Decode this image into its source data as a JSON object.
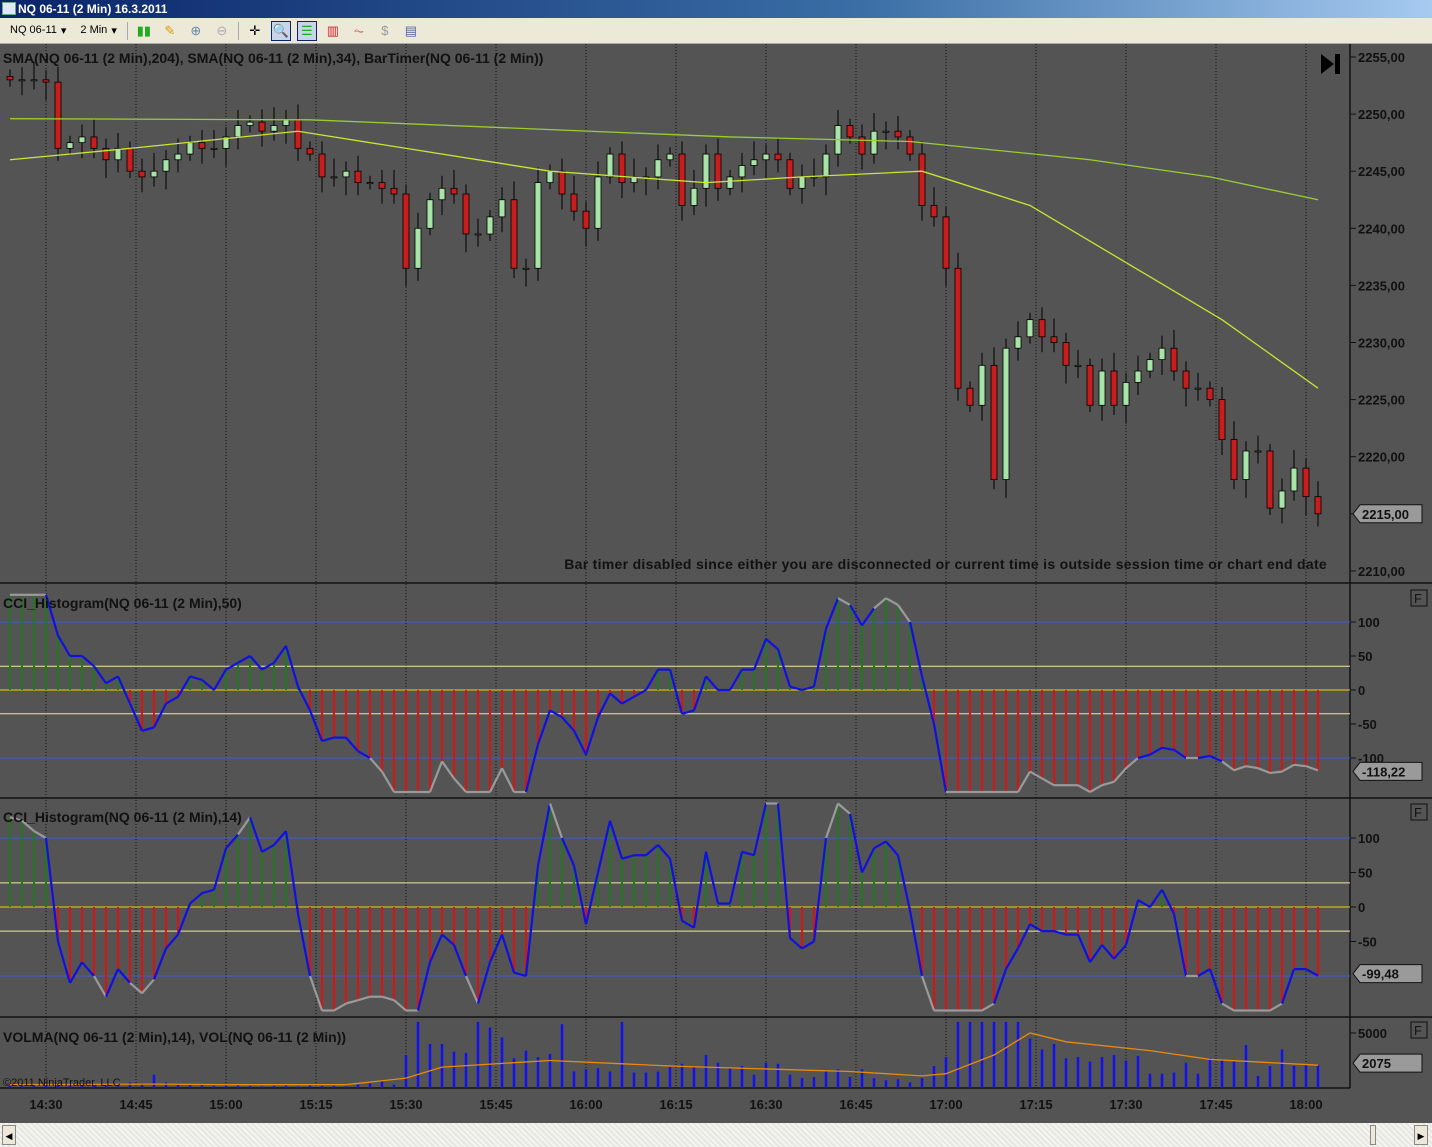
{
  "window": {
    "title": "NQ 06-11 (2 Min)  16.3.2011"
  },
  "toolbar": {
    "instrument": "NQ 06-11",
    "interval": "2 Min",
    "icons": [
      "bar-style-icon",
      "drawing-pencil-icon",
      "zoom-in-icon",
      "zoom-out-icon",
      "crosshair-icon",
      "data-box-icon",
      "chart-trader-icon",
      "indicators-icon",
      "strategies-icon",
      "properties-icon"
    ]
  },
  "panels": {
    "price": {
      "label": "SMA(NQ 06-11 (2 Min),204), SMA(NQ 06-11 (2 Min),34), BarTimer(NQ 06-11 (2 Min))",
      "ticks": [
        "2255,00",
        "2250,00",
        "2245,00",
        "2240,00",
        "2235,00",
        "2230,00",
        "2225,00",
        "2220,00",
        "2215,00",
        "2210,00"
      ],
      "last": "2215,00",
      "message": "Bar timer disabled since either you are disconnected or current time is outside session time or chart end date"
    },
    "cci50": {
      "label": "CCI_Histogram(NQ 06-11 (2 Min),50)",
      "ticks": [
        "100",
        "50",
        "0",
        "-50",
        "-100"
      ],
      "last": "-118,22",
      "button": "F"
    },
    "cci14": {
      "label": "CCI_Histogram(NQ 06-11 (2 Min),14)",
      "ticks": [
        "100",
        "50",
        "0",
        "-50"
      ],
      "last": "-99,48",
      "button": "F"
    },
    "vol": {
      "label": "VOLMA(NQ 06-11 (2 Min),14), VOL(NQ 06-11 (2 Min))",
      "ticks": [
        "5000"
      ],
      "last": "2075",
      "button": "F",
      "copyright": "©2011 NinjaTrader, LLC"
    }
  },
  "time_labels": [
    "14:30",
    "14:45",
    "15:00",
    "15:15",
    "15:30",
    "15:45",
    "16:00",
    "16:15",
    "16:30",
    "16:45",
    "17:00",
    "17:15",
    "17:30",
    "17:45",
    "18:00"
  ],
  "colors": {
    "up": "#a8e4a8",
    "down": "#c81e1e",
    "sma204": "#9acd32",
    "sma34": "#c8e632",
    "cci_line": "#1010e0",
    "cci_ext": "#9a9a9a",
    "hist_pos": "#1f7a1f",
    "hist_neg": "#e01010",
    "volume": "#1010f0",
    "volma": "#e88a10"
  },
  "chart_data": {
    "type": "candlestick",
    "bar_interval_min": 2,
    "first_bar": "14:24",
    "close": [
      2253,
      2253,
      2253,
      2252.8,
      2247,
      2247.5,
      2248,
      2247,
      2246,
      2247,
      2245,
      2244.5,
      2245,
      2246,
      2246.5,
      2247.5,
      2247,
      2247,
      2248,
      2249,
      2249.3,
      2248.5,
      2249,
      2249.5,
      2247,
      2246.5,
      2244.5,
      2244.5,
      2245,
      2244,
      2244,
      2243.5,
      2243,
      2236.5,
      2240,
      2242.5,
      2243.5,
      2243,
      2239.5,
      2239.5,
      2241,
      2242.5,
      2236.5,
      2236.5,
      2244,
      2245,
      2243,
      2241.5,
      2240,
      2244.5,
      2246.5,
      2244,
      2244.5,
      2244.5,
      2246,
      2246.5,
      2242,
      2243.5,
      2246.5,
      2243.5,
      2244.5,
      2245.5,
      2246,
      2246.5,
      2246,
      2243.5,
      2244.5,
      2244.5,
      2246.5,
      2249,
      2248,
      2246.5,
      2248.5,
      2248.5,
      2248,
      2246.5,
      2242,
      2241,
      2236.5,
      2226,
      2224.5,
      2228,
      2218,
      2229.5,
      2230.5,
      2232,
      2230.5,
      2230,
      2228,
      2228,
      2224.5,
      2227.5,
      2224.5,
      2226.5,
      2227.5,
      2228.5,
      2229.5,
      2227.5,
      2226,
      2226,
      2225,
      2221.5,
      2218,
      2220.5,
      2220.5,
      2215.5,
      2217,
      2219,
      2216.5,
      2215
    ],
    "sma204": [
      [
        0,
        2249.6
      ],
      [
        25,
        2249.5
      ],
      [
        60,
        2248
      ],
      [
        75,
        2247.6
      ],
      [
        90,
        2246
      ],
      [
        100,
        2244.5
      ],
      [
        109,
        2242.5
      ]
    ],
    "sma34": [
      [
        0,
        2246
      ],
      [
        10,
        2247
      ],
      [
        24,
        2248.5
      ],
      [
        45,
        2245
      ],
      [
        58,
        2244
      ],
      [
        66,
        2244.5
      ],
      [
        76,
        2245
      ],
      [
        85,
        2242
      ],
      [
        93,
        2237
      ],
      [
        101,
        2232
      ],
      [
        109,
        2226
      ]
    ],
    "cci50": [
      140,
      140,
      140,
      140,
      80,
      50,
      50,
      35,
      10,
      20,
      -20,
      -60,
      -55,
      -20,
      -10,
      20,
      15,
      0,
      30,
      40,
      50,
      30,
      40,
      65,
      5,
      -30,
      -75,
      -70,
      -70,
      -90,
      -100,
      -120,
      -150,
      -150,
      -150,
      -150,
      -105,
      -130,
      -150,
      -150,
      -150,
      -115,
      -150,
      -150,
      -80,
      -30,
      -40,
      -60,
      -95,
      -40,
      -5,
      -20,
      -10,
      0,
      30,
      30,
      -35,
      -30,
      20,
      0,
      0,
      30,
      30,
      75,
      60,
      5,
      0,
      5,
      90,
      135,
      125,
      95,
      120,
      135,
      125,
      100,
      20,
      -50,
      -150,
      -150,
      -150,
      -150,
      -150,
      -150,
      -150,
      -120,
      -130,
      -140,
      -140,
      -140,
      -150,
      -140,
      -135,
      -115,
      -100,
      -95,
      -85,
      -88,
      -100,
      -100,
      -97,
      -105,
      -118,
      -112,
      -115,
      -122,
      -120,
      -110,
      -112,
      -118.22
    ],
    "cci14": [
      130,
      125,
      110,
      100,
      -50,
      -110,
      -80,
      -100,
      -130,
      -90,
      -110,
      -125,
      -105,
      -60,
      -40,
      5,
      20,
      25,
      85,
      105,
      130,
      80,
      90,
      110,
      -10,
      -100,
      -150,
      -150,
      -140,
      -135,
      -130,
      -130,
      -135,
      -150,
      -150,
      -80,
      -40,
      -55,
      -100,
      -140,
      -80,
      -40,
      -95,
      -100,
      60,
      150,
      100,
      60,
      -25,
      50,
      125,
      70,
      75,
      75,
      90,
      70,
      -20,
      -30,
      80,
      5,
      5,
      80,
      75,
      150,
      150,
      -45,
      -60,
      -50,
      100,
      150,
      135,
      50,
      85,
      95,
      75,
      -5,
      -100,
      -150,
      -150,
      -150,
      -150,
      -150,
      -140,
      -90,
      -60,
      -25,
      -35,
      -35,
      -40,
      -40,
      -80,
      -55,
      -75,
      -55,
      10,
      0,
      25,
      -10,
      -100,
      -100,
      -90,
      -140,
      -150,
      -150,
      -150,
      -150,
      -140,
      -90,
      -90,
      -99.48
    ],
    "volume": [
      200,
      300,
      200,
      250,
      300,
      200,
      300,
      250,
      200,
      300,
      500,
      400,
      1200,
      500,
      300,
      250,
      300,
      200,
      200,
      250,
      200,
      150,
      200,
      250,
      150,
      300,
      200,
      200,
      150,
      300,
      400,
      700,
      300,
      3000,
      6000,
      4000,
      4000,
      3300,
      3200,
      6000,
      5500,
      4600,
      2700,
      3400,
      2800,
      3100,
      5800,
      1500,
      1700,
      1800,
      1500,
      6000,
      1400,
      1400,
      1500,
      1900,
      2200,
      2000,
      3000,
      2300,
      1800,
      2000,
      1200,
      2300,
      2200,
      1200,
      900,
      1000,
      1500,
      1700,
      1000,
      1700,
      900,
      700,
      800,
      500,
      900,
      2000,
      2800,
      6000,
      6000,
      6000,
      6000,
      6000,
      6000,
      4500,
      3500,
      4000,
      2700,
      2800,
      2400,
      2800,
      3000,
      2500,
      2900,
      1300,
      1300,
      1400,
      2300,
      1300,
      2700,
      2600,
      2400,
      3900,
      1100,
      2000,
      3500,
      2000,
      2100,
      2075
    ],
    "volma": [
      [
        0,
        300
      ],
      [
        12,
        350
      ],
      [
        18,
        300
      ],
      [
        28,
        300
      ],
      [
        33,
        900
      ],
      [
        36,
        1900
      ],
      [
        45,
        2500
      ],
      [
        55,
        2000
      ],
      [
        70,
        1500
      ],
      [
        76,
        1100
      ],
      [
        78,
        1300
      ],
      [
        82,
        3000
      ],
      [
        85,
        5000
      ],
      [
        88,
        4200
      ],
      [
        95,
        3400
      ],
      [
        100,
        2600
      ],
      [
        109,
        2075
      ]
    ],
    "price_range": [
      2210,
      2255
    ],
    "cci_range": [
      -150,
      150
    ],
    "volume_range": [
      0,
      6000
    ]
  }
}
